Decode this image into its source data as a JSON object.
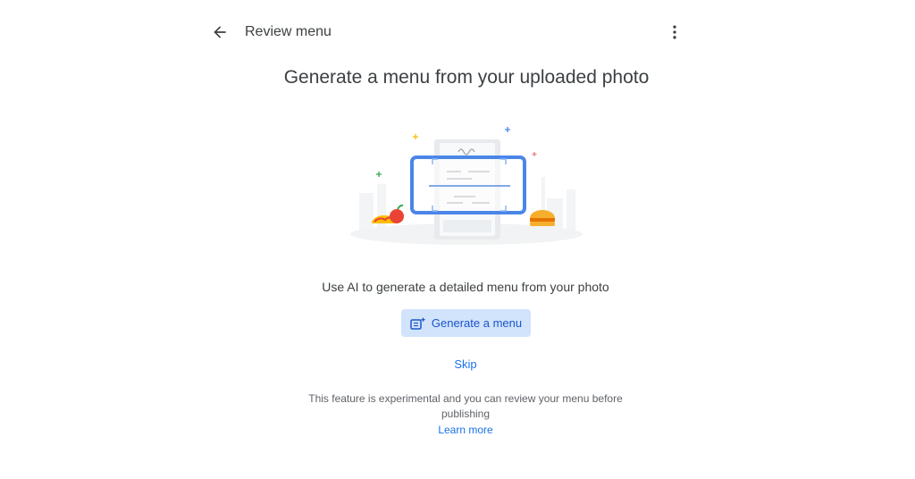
{
  "header": {
    "title": "Review menu",
    "back_icon": "arrow-back-icon",
    "more_icon": "more-vert-icon"
  },
  "main": {
    "headline": "Generate a menu from your uploaded photo",
    "illustration_icon": "menu-scan-illustration",
    "subtitle": "Use AI to generate a detailed menu from your photo",
    "generate_button": {
      "label": "Generate a menu",
      "icon": "ai-menu-icon"
    },
    "skip_label": "Skip",
    "disclaimer": "This feature is experimental and you can review your menu before publishing",
    "learn_more_label": "Learn more"
  },
  "colors": {
    "primary": "#1a73e8",
    "button_bg": "#d2e3fc",
    "button_text": "#1a56c9",
    "text": "#3c4043",
    "muted": "#5f6368"
  }
}
